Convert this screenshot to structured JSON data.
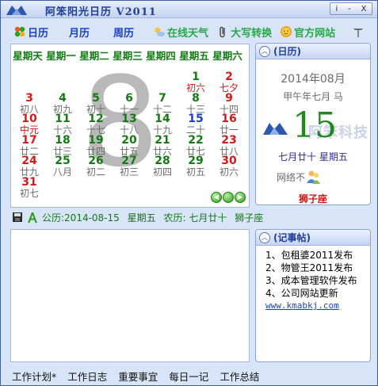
{
  "window": {
    "title": "阿笨阳光日历 V2011",
    "buttons": {
      "minimize": "i",
      "restore": "-",
      "close": "X"
    }
  },
  "toolbar": {
    "items": [
      {
        "label": "日历",
        "icon": "calendar-beads-icon"
      },
      {
        "label": "月历",
        "icon": ""
      },
      {
        "label": "周历",
        "icon": ""
      },
      {
        "label": "在线天气",
        "icon": "weather-icon"
      },
      {
        "label": "大写转换",
        "icon": "paperclip-icon"
      },
      {
        "label": "官方网站",
        "icon": "sun-face-icon"
      }
    ],
    "settings_icon": "tools-icon"
  },
  "calendar": {
    "weekdays": [
      "星期天",
      "星期一",
      "星期二",
      "星期三",
      "星期四",
      "星期五",
      "星期六"
    ],
    "big_month_number": "8",
    "colors": {
      "weekend": "#d11a1a",
      "weekday": "#137a14",
      "today": "#1a3fd0"
    },
    "weeks": [
      [
        null,
        null,
        null,
        null,
        null,
        {
          "day": "1",
          "lunar": "初六",
          "color": "weekday",
          "lunar_color": "red"
        },
        {
          "day": "2",
          "lunar": "七夕",
          "color": "weekend",
          "lunar_color": "red"
        }
      ],
      [
        {
          "day": "3",
          "lunar": "初八",
          "color": "weekend"
        },
        {
          "day": "4",
          "lunar": "初九",
          "color": "weekday"
        },
        {
          "day": "5",
          "lunar": "初十",
          "color": "weekday"
        },
        {
          "day": "6",
          "lunar": "十一",
          "color": "weekday"
        },
        {
          "day": "7",
          "lunar": "十二",
          "color": "weekday"
        },
        {
          "day": "8",
          "lunar": "十三",
          "color": "weekday"
        },
        {
          "day": "9",
          "lunar": "十四",
          "color": "weekend"
        }
      ],
      [
        {
          "day": "10",
          "lunar": "中元",
          "color": "weekend",
          "lunar_color": "red"
        },
        {
          "day": "11",
          "lunar": "十六",
          "color": "weekday"
        },
        {
          "day": "12",
          "lunar": "十七",
          "color": "weekday"
        },
        {
          "day": "13",
          "lunar": "十八",
          "color": "weekday"
        },
        {
          "day": "14",
          "lunar": "十九",
          "color": "weekday"
        },
        {
          "day": "15",
          "lunar": "二十",
          "color": "today"
        },
        {
          "day": "16",
          "lunar": "廿一",
          "color": "weekend"
        }
      ],
      [
        {
          "day": "17",
          "lunar": "廿二",
          "color": "weekend"
        },
        {
          "day": "18",
          "lunar": "廿三",
          "color": "weekday"
        },
        {
          "day": "19",
          "lunar": "廿四",
          "color": "weekday"
        },
        {
          "day": "20",
          "lunar": "廿五",
          "color": "weekday"
        },
        {
          "day": "21",
          "lunar": "廿六",
          "color": "weekday"
        },
        {
          "day": "22",
          "lunar": "廿七",
          "color": "weekday"
        },
        {
          "day": "23",
          "lunar": "廿八",
          "color": "weekend"
        }
      ],
      [
        {
          "day": "24",
          "lunar": "廿九",
          "color": "weekend"
        },
        {
          "day": "25",
          "lunar": "八月",
          "color": "weekday"
        },
        {
          "day": "26",
          "lunar": "初二",
          "color": "weekday"
        },
        {
          "day": "27",
          "lunar": "初三",
          "color": "weekday"
        },
        {
          "day": "28",
          "lunar": "初四",
          "color": "weekday"
        },
        {
          "day": "29",
          "lunar": "初五",
          "color": "weekday"
        },
        {
          "day": "30",
          "lunar": "初六",
          "color": "weekend"
        }
      ],
      [
        {
          "day": "31",
          "lunar": "初七",
          "color": "weekend"
        },
        null,
        null,
        null,
        null,
        null,
        null
      ]
    ]
  },
  "infobar": {
    "solar_label": "公历:",
    "solar_date": "2014-08-15",
    "weekday": "星期五",
    "lunar_label": "农历:",
    "lunar_date": "七月廿十",
    "zodiac": "狮子座"
  },
  "today_panel": {
    "title": "(日历)",
    "year_month": "2014年08月",
    "ganzhi": "甲午年七月 马",
    "day": "15",
    "watermark": "阿笨科技",
    "lunar_line": "七月廿十  星期五",
    "network_text": "网络不",
    "zodiac": "狮子座"
  },
  "memo_panel": {
    "title": "(记事帖)",
    "items": [
      "1、包租婆2011发布",
      "2、物管王2011发布",
      "3、成本管理软件发布",
      "4、公司网站更新"
    ],
    "link": "www.kmabkj.com"
  },
  "bottom_tabs": [
    "工作计划*",
    "工作日志",
    "重要事宜",
    "每日一记",
    "工作总结"
  ]
}
